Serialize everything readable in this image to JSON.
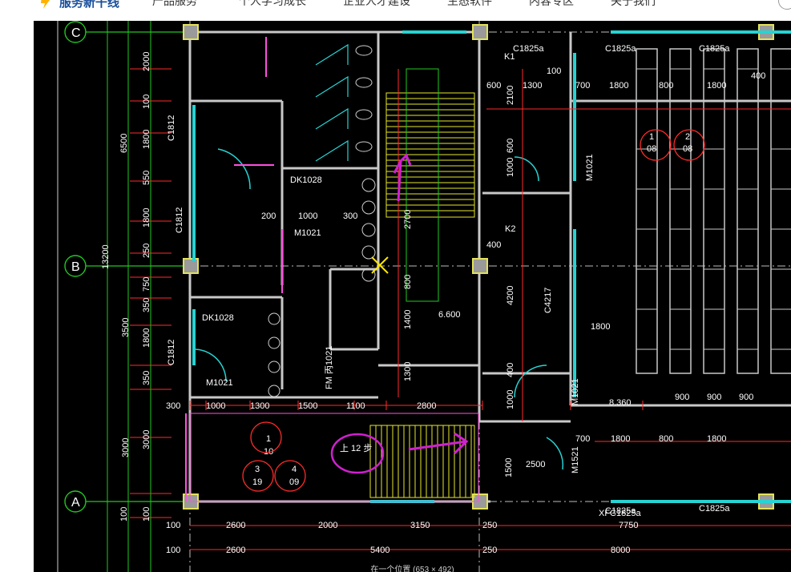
{
  "header": {
    "logo_text": "服务新干线",
    "nav": [
      "产品服务",
      "个人学习成长",
      "企业人才建设",
      "生态软件",
      "内容专区",
      "关于我们"
    ]
  },
  "viewer": {
    "caption": "在一个位置 (653 × 492)"
  },
  "drawing": {
    "grid_axes": [
      "C",
      "B",
      "A"
    ],
    "left_dims": [
      "6500",
      "3500",
      "3000",
      "2000",
      "100",
      "1800",
      "550",
      "1800",
      "250",
      "750",
      "350",
      "1800",
      "350",
      "3000",
      "100",
      "100",
      "13200"
    ],
    "bottom_dims_row1": [
      "100",
      "2600",
      "2000",
      "3150",
      "250",
      "7750"
    ],
    "bottom_dims_row2": [
      "100",
      "2600",
      "5400",
      "250",
      "8000"
    ],
    "inner_dims": [
      "300",
      "1000",
      "1300",
      "1500",
      "1100",
      "2800",
      "400",
      "200",
      "1000",
      "300",
      "600",
      "1300",
      "700",
      "1800",
      "800",
      "1800",
      "400",
      "900",
      "900",
      "900",
      "8.360",
      "6.600",
      "2700",
      "800",
      "1400",
      "1300",
      "1500",
      "2500",
      "4200",
      "400",
      "1000",
      "2100",
      "600",
      "1000",
      "700",
      "1800",
      "800",
      "1800",
      "1800"
    ],
    "labels": [
      "DK1028",
      "DK1028",
      "M1021",
      "M1021",
      "C1812",
      "C1812",
      "C1812",
      "C1825a",
      "C1825a",
      "C1825a",
      "C4217",
      "C1825a",
      "C1825a",
      "XFC1825a",
      "FM 丙1021",
      "M1021",
      "M1521",
      "M1021",
      "上 12 步",
      "1",
      "10",
      "3",
      "19",
      "4",
      "09",
      "1",
      "08",
      "2",
      "08",
      "K1",
      "K2",
      "100"
    ]
  },
  "colors": {
    "background": "#000000",
    "wall": "#c8c8c8",
    "dim": "#ff2a2a",
    "axis": "#22c722",
    "window": "#27d3d3",
    "door": "#ff4fe0",
    "stair": "#e6e62a",
    "text": "#ffffff",
    "annot": "#d020d0"
  }
}
